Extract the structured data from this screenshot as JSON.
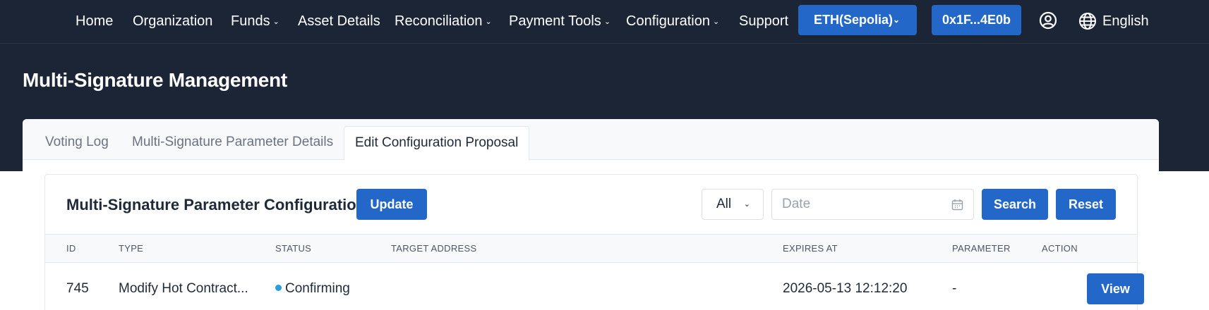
{
  "nav": {
    "items": [
      {
        "label": "Home",
        "dropdown": false
      },
      {
        "label": "Organization",
        "dropdown": false
      },
      {
        "label": "Funds",
        "dropdown": true
      },
      {
        "label": "Asset Details",
        "dropdown": false
      },
      {
        "label": "Reconciliation",
        "dropdown": true
      },
      {
        "label": "Payment Tools",
        "dropdown": true
      },
      {
        "label": "Configuration",
        "dropdown": true
      },
      {
        "label": "Support",
        "dropdown": false
      }
    ],
    "network_label": "ETH(Sepolia)",
    "wallet_address": "0x1F...4E0b",
    "language": "English",
    "icons": [
      "chevron-down-icon",
      "user-circle-icon",
      "globe-icon"
    ]
  },
  "page": {
    "title": "Multi-Signature Management"
  },
  "tabs": [
    {
      "label": "Voting Log",
      "active": false
    },
    {
      "label": "Multi-Signature Parameter Details",
      "active": false
    },
    {
      "label": "Edit Configuration Proposal",
      "active": true
    }
  ],
  "panel": {
    "title": "Multi-Signature Parameter Configuration",
    "update_label": "Update",
    "filter_selected": "All",
    "date_placeholder": "Date",
    "search_label": "Search",
    "reset_label": "Reset"
  },
  "table": {
    "columns": [
      "ID",
      "TYPE",
      "STATUS",
      "TARGET ADDRESS",
      "EXPIRES AT",
      "PARAMETER",
      "ACTION"
    ],
    "rows": [
      {
        "id": "745",
        "type": "Modify Hot Contract...",
        "status": "Confirming",
        "target_address": "",
        "expires_at": "2026-05-13 12:12:20",
        "parameter": "-",
        "action": "View"
      }
    ]
  },
  "colors": {
    "header_bg": "#1b2535",
    "primary": "#2368c9",
    "status_confirming": "#2d9cdb"
  }
}
